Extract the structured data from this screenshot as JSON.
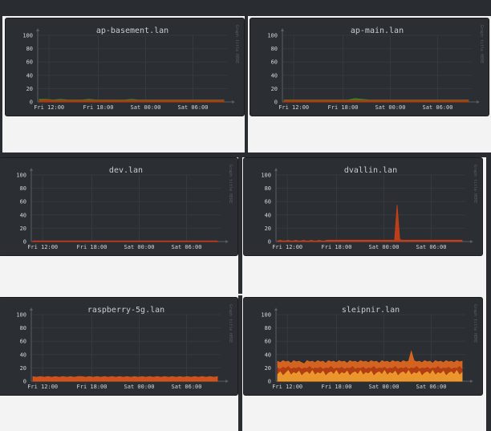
{
  "layout": {
    "background": "#f3f3f3",
    "panel_color": "#2b2e33"
  },
  "chart_data": [
    {
      "type": "area",
      "title": "ap-basement.lan",
      "vlabel": "Graph title HERE",
      "categories": [
        "Fri 12:00",
        "Fri 18:00",
        "Sat 00:00",
        "Sat 06:00"
      ],
      "ylim": [
        0,
        100
      ],
      "yticks": [
        0,
        20,
        40,
        60,
        80,
        100
      ],
      "grid": true,
      "series": [
        {
          "color": "#3a8a1f",
          "values": [
            4,
            4,
            3,
            4,
            3,
            3,
            3,
            4,
            3,
            3,
            3,
            3,
            3,
            4,
            3,
            3,
            3,
            3,
            3,
            3,
            3,
            3,
            3,
            3,
            3,
            3,
            3
          ]
        },
        {
          "color": "#c03010",
          "values": [
            2,
            3,
            2,
            2,
            2,
            2,
            2,
            2,
            2,
            2,
            2,
            2,
            2,
            2,
            2,
            2,
            2,
            2,
            2,
            2,
            2,
            2,
            2,
            2,
            2,
            2,
            2
          ]
        }
      ]
    },
    {
      "type": "area",
      "title": "ap-main.lan",
      "vlabel": "Graph title HERE",
      "categories": [
        "Fri 12:00",
        "Fri 18:00",
        "Sat 00:00",
        "Sat 06:00"
      ],
      "ylim": [
        0,
        100
      ],
      "yticks": [
        0,
        20,
        40,
        60,
        80,
        100
      ],
      "grid": true,
      "series": [
        {
          "color": "#3a8a1f",
          "values": [
            3,
            3,
            3,
            3,
            3,
            3,
            3,
            3,
            3,
            3,
            5,
            4,
            3,
            3,
            3,
            3,
            3,
            3,
            3,
            3,
            3,
            3,
            3,
            3,
            3,
            3,
            3
          ]
        },
        {
          "color": "#c03010",
          "values": [
            2,
            2,
            2,
            2,
            2,
            2,
            2,
            2,
            2,
            2,
            2,
            2,
            2,
            2,
            2,
            2,
            2,
            2,
            2,
            2,
            2,
            2,
            2,
            2,
            2,
            2,
            2
          ]
        }
      ]
    },
    {
      "type": "area",
      "title": "dev.lan",
      "vlabel": "Graph title HERE",
      "categories": [
        "Fri 12:00",
        "Fri 18:00",
        "Sat 00:00",
        "Sat 06:00"
      ],
      "ylim": [
        0,
        100
      ],
      "yticks": [
        0,
        20,
        40,
        60,
        80,
        100
      ],
      "grid": true,
      "series": [
        {
          "color": "#d03812",
          "values": [
            1,
            1,
            1,
            1,
            1,
            1,
            1,
            1,
            1,
            1,
            1,
            1,
            1,
            1,
            1,
            1,
            1,
            1,
            1,
            1,
            1,
            1,
            1,
            1,
            1,
            1,
            1
          ]
        }
      ]
    },
    {
      "type": "area",
      "title": "dvallin.lan",
      "vlabel": "Graph title HERE",
      "categories": [
        "Fri 12:00",
        "Fri 18:00",
        "Sat 00:00",
        "Sat 06:00"
      ],
      "ylim": [
        0,
        100
      ],
      "yticks": [
        0,
        20,
        40,
        60,
        80,
        100
      ],
      "grid": true,
      "series": [
        {
          "color": "#c8401a",
          "values": [
            1,
            2,
            1,
            1,
            2,
            1,
            1,
            2,
            1,
            1,
            2,
            1,
            1,
            2,
            1,
            1,
            2,
            1,
            1,
            2,
            2,
            2,
            2,
            2,
            2,
            2,
            2,
            2,
            2,
            2,
            2,
            2,
            2,
            2,
            2,
            2,
            2,
            2,
            2,
            2,
            2,
            2,
            2,
            2,
            2,
            2,
            55,
            3,
            2,
            2,
            2,
            2,
            2,
            2,
            2,
            2,
            2,
            2,
            2,
            2,
            2,
            2,
            2,
            2,
            2,
            2,
            2,
            2,
            2,
            2,
            2,
            2
          ]
        }
      ]
    },
    {
      "type": "area",
      "title": "raspberry-5g.lan",
      "vlabel": "Graph title HERE",
      "categories": [
        "Fri 12:00",
        "Fri 18:00",
        "Sat 00:00",
        "Sat 06:00"
      ],
      "ylim": [
        0,
        100
      ],
      "yticks": [
        0,
        20,
        40,
        60,
        80,
        100
      ],
      "grid": true,
      "series": [
        {
          "color": "#e0561a",
          "values": [
            7,
            6,
            7,
            6,
            7,
            6,
            7,
            6,
            7,
            6,
            7,
            6,
            7,
            7,
            6,
            7,
            6,
            7,
            6,
            7,
            6,
            7,
            6,
            7,
            6,
            7,
            6,
            7,
            6,
            7,
            6,
            7,
            6,
            7,
            6,
            7,
            6,
            7,
            6,
            7,
            6,
            7,
            6,
            7,
            6,
            7,
            6,
            7,
            6,
            7
          ]
        }
      ]
    },
    {
      "type": "area",
      "title": "sleipnir.lan",
      "vlabel": "Graph title HERE",
      "categories": [
        "Fri 12:00",
        "Fri 18:00",
        "Sat 00:00",
        "Sat 06:00"
      ],
      "ylim": [
        0,
        100
      ],
      "yticks": [
        0,
        20,
        40,
        60,
        80,
        100
      ],
      "grid": true,
      "series": [
        {
          "color": "#e4691e",
          "values": [
            30,
            28,
            31,
            29,
            30,
            27,
            31,
            29,
            30,
            28,
            26,
            31,
            29,
            30,
            28,
            31,
            29,
            30,
            27,
            31,
            29,
            30,
            28,
            31,
            29,
            30,
            27,
            31,
            29,
            30,
            28,
            31,
            29,
            30,
            28,
            31,
            29,
            30,
            27,
            31,
            29,
            30,
            28,
            31,
            29,
            30,
            28,
            31,
            29,
            30,
            45,
            31,
            29,
            30,
            28,
            31,
            29,
            30,
            27,
            31,
            29,
            30,
            28,
            31,
            29,
            30,
            28,
            31,
            29,
            30
          ]
        },
        {
          "color": "#b03a12",
          "values": [
            20,
            18,
            21,
            19,
            22,
            18,
            20,
            19,
            21,
            18,
            20,
            19,
            22,
            18,
            20,
            19,
            21,
            18,
            20,
            19,
            22,
            18,
            20,
            19,
            21,
            18,
            20,
            19,
            22,
            18,
            20,
            19,
            21,
            18,
            20,
            19,
            22,
            18,
            20,
            19,
            21,
            18,
            20,
            19,
            22,
            18,
            20,
            19,
            21,
            18,
            20,
            19,
            22,
            18,
            20,
            19,
            21,
            18,
            20,
            19,
            22,
            18,
            20,
            19,
            21,
            18,
            20,
            19,
            22,
            18
          ]
        },
        {
          "color": "#f0a030",
          "values": [
            10,
            14,
            8,
            12,
            16,
            9,
            13,
            11,
            15,
            8,
            12,
            14,
            10,
            16,
            9,
            13,
            11,
            15,
            8,
            12,
            14,
            10,
            16,
            9,
            13,
            11,
            15,
            8,
            12,
            14,
            10,
            16,
            9,
            13,
            11,
            15,
            8,
            12,
            14,
            10,
            16,
            9,
            13,
            11,
            15,
            8,
            12,
            14,
            10,
            16,
            9,
            13,
            11,
            15,
            8,
            12,
            14,
            10,
            16,
            9,
            13,
            11,
            15,
            8,
            12,
            14,
            10,
            16,
            9,
            13
          ]
        }
      ]
    }
  ]
}
